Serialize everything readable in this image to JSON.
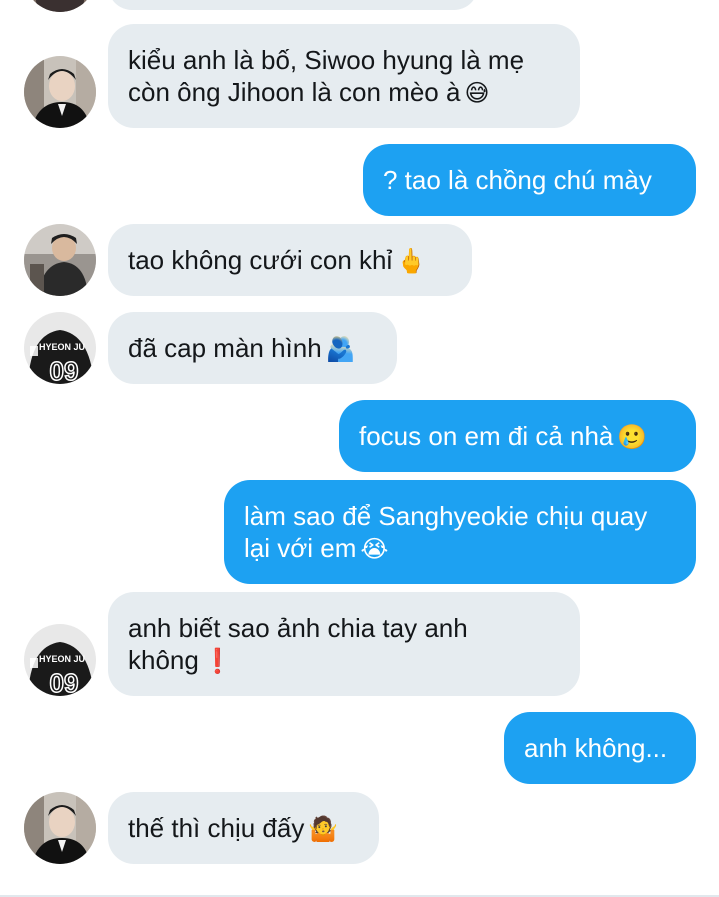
{
  "conversation": {
    "messages": [
      {
        "sender": "them",
        "text": "",
        "emoji": ""
      },
      {
        "sender": "them",
        "text": "kiểu anh là bố, Siwoo hyung là mẹ còn ông Jihoon là con mèo à",
        "emoji": "😅"
      },
      {
        "sender": "me",
        "text": "? tao là chồng chú mày",
        "emoji": ""
      },
      {
        "sender": "them",
        "text": "tao không cưới con khỉ",
        "emoji": "🖕"
      },
      {
        "sender": "them",
        "text": "đã cap màn hình",
        "emoji": "🫂"
      },
      {
        "sender": "me",
        "text": "focus on em đi cả nhà",
        "emoji": "🥲"
      },
      {
        "sender": "me",
        "text": "làm sao để Sanghyeokie chịu quay lại với em",
        "emoji": "😭"
      },
      {
        "sender": "them",
        "text": "anh biết sao ảnh chia tay anh không",
        "emoji": "❗"
      },
      {
        "sender": "me",
        "text": "anh không...",
        "emoji": ""
      },
      {
        "sender": "them",
        "text": "thế thì chịu đấy",
        "emoji": "🤷"
      }
    ],
    "avatars": {
      "suit_person": "avatar-person-in-dark-suit",
      "seated_person": "avatar-person-seated",
      "jersey": "avatar-jersey-hyeon-jun",
      "jersey_text": "HYEON JU",
      "jersey_number": "09"
    },
    "colors": {
      "incoming_bubble": "#e6ecf0",
      "outgoing_bubble": "#1da1f2",
      "incoming_text": "#14171a",
      "outgoing_text": "#ffffff"
    }
  }
}
